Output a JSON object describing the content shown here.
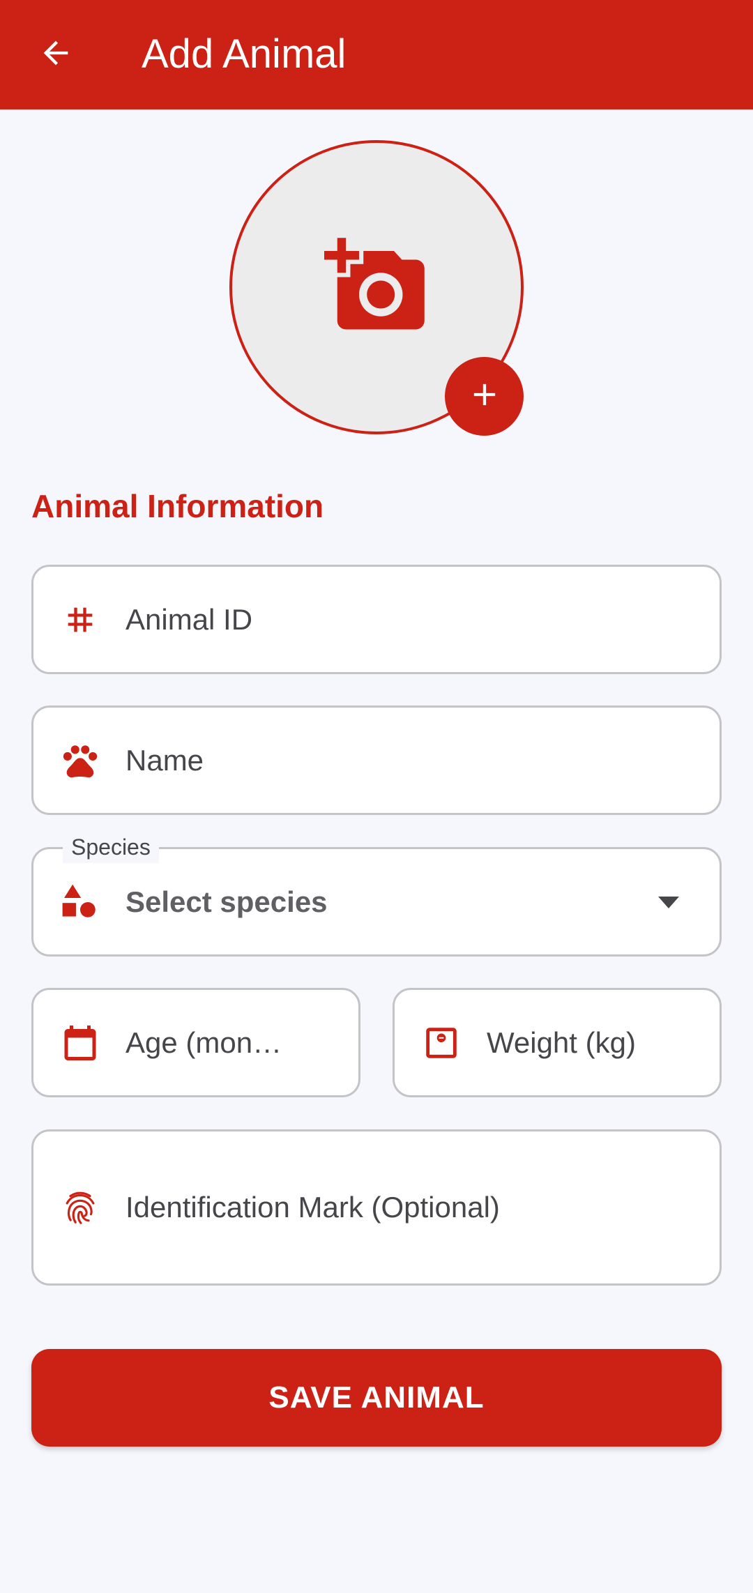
{
  "appbar": {
    "title": "Add Animal",
    "back_icon": "arrow-back-icon"
  },
  "photo": {
    "icon": "add-a-photo-icon",
    "add_button_icon": "plus-icon"
  },
  "section_title": "Animal Information",
  "fields": {
    "animal_id": {
      "placeholder": "Animal ID",
      "icon": "hash-icon"
    },
    "name": {
      "placeholder": "Name",
      "icon": "paw-icon"
    },
    "species": {
      "label": "Species",
      "placeholder": "Select species",
      "icon": "category-shapes-icon"
    },
    "age": {
      "placeholder": "Age (mon…",
      "icon": "calendar-icon"
    },
    "weight": {
      "placeholder": "Weight (kg)",
      "icon": "scale-icon"
    },
    "identification_mark": {
      "placeholder": "Identification Mark (Optional)",
      "icon": "fingerprint-icon"
    }
  },
  "save_button": "SAVE ANIMAL",
  "colors": {
    "primary": "#cc2115",
    "background": "#f6f7fc",
    "field_border": "#c4c4c8",
    "text": "#45454a"
  }
}
